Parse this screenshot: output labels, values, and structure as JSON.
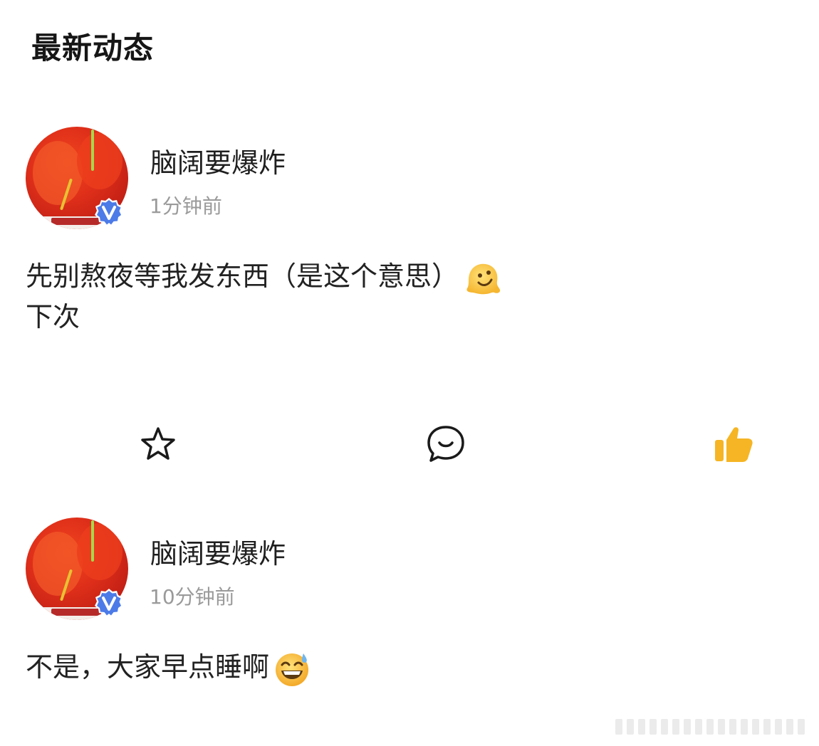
{
  "header": {
    "title": "最新动态"
  },
  "posts": [
    {
      "user": {
        "name": "脑阔要爆炸"
      },
      "time": "1分钟前",
      "content": {
        "line1": "先别熬夜等我发东西（是这个意思）",
        "line2": "下次"
      },
      "emoji": "melting-face-emoji"
    },
    {
      "user": {
        "name": "脑阔要爆炸"
      },
      "time": "10分钟前",
      "content": {
        "line1": "不是，大家早点睡啊"
      },
      "emoji": "grinning-sweat-emoji"
    }
  ],
  "actions": {
    "favorite_icon": "star-outline-icon",
    "comment_icon": "comment-bubble-icon",
    "like_icon": "thumbs-up-icon",
    "like_color": "#f5b524"
  },
  "colors": {
    "verified_badge": "#4c7be8",
    "title_accent": "#f7a64a",
    "secondary_text": "#9a9a9a"
  }
}
